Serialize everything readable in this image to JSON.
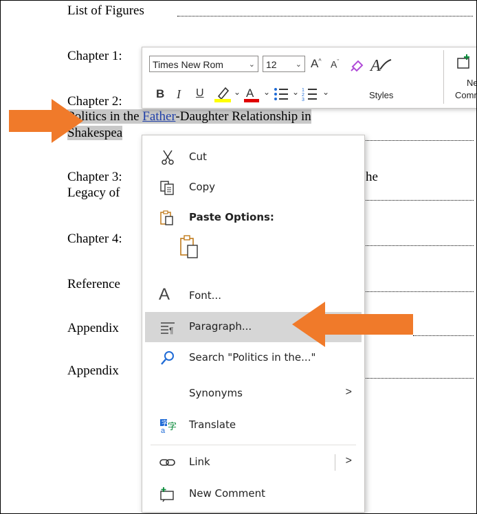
{
  "document": {
    "list_of_figures": "List of Figures",
    "ch1": "Chapter 1:",
    "ch2": "Chapter 2:",
    "ch2_line2_a": "Politics in the ",
    "ch2_line2_link": "Father",
    "ch2_line2_b": "-Daughter Relationship in",
    "ch2_line3": "Shakespea",
    "ch3": "Chapter 3:",
    "ch3_tail": "he",
    "ch3_line2": "Legacy of",
    "ch4": "Chapter 4:",
    "references": "Reference",
    "appendix1": "Appendix",
    "appendix2": "Appendix"
  },
  "mini_toolbar": {
    "font_name": "Times New Rom",
    "font_size": "12",
    "styles_label": "Styles",
    "new_comment_label_1": "Ne",
    "new_comment_label_2": "Comm",
    "bold": "B",
    "italic": "I",
    "underline": "U",
    "highlight_color": "#ffff00",
    "font_color": "#e00000"
  },
  "context_menu": {
    "items": [
      {
        "label": "Cut",
        "icon": "scissors-icon"
      },
      {
        "label": "Copy",
        "icon": "copy-icon"
      },
      {
        "label": "Paste Options:",
        "icon": "paste-icon"
      },
      {
        "label": "Font...",
        "icon": "font-icon"
      },
      {
        "label": "Paragraph...",
        "icon": "paragraph-icon"
      },
      {
        "label": "Search \"Politics in the...\"",
        "icon": "search-icon"
      },
      {
        "label": "Synonyms",
        "icon": ""
      },
      {
        "label": "Translate",
        "icon": "translate-icon"
      },
      {
        "label": "Link",
        "icon": "link-icon"
      },
      {
        "label": "New Comment",
        "icon": "new-comment-icon"
      }
    ],
    "submenu_glyph": ">"
  },
  "colors": {
    "arrow": "#f07a2a",
    "selection": "#c8c8c8",
    "accent_blue": "#1f6bd6",
    "highlight_row": "#d6d6d6"
  }
}
